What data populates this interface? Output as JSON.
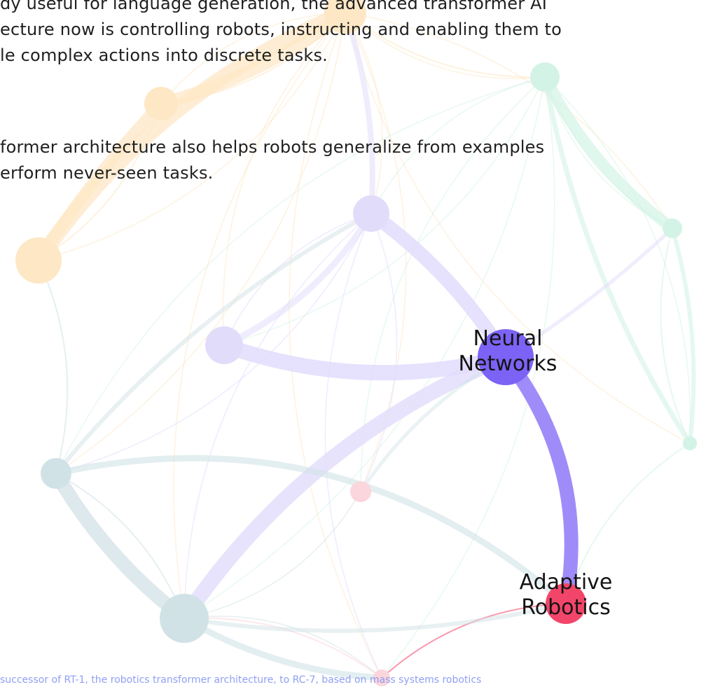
{
  "article": {
    "paragraph1": [
      "dy useful for language generation, the advanced transformer AI",
      "ecture now is controlling robots, instructing and enabling them to",
      "le complex actions into discrete tasks."
    ],
    "paragraph2": [
      "former architecture also helps robots generalize from examples",
      "erform never-seen tasks."
    ],
    "caption": "successor of RT-1, the robotics transformer architecture, to RC-7, based on mass systems robotics"
  },
  "graph": {
    "labels": {
      "neural_networks": [
        "Neural",
        "Networks"
      ],
      "adaptive_robotics": [
        "Adaptive",
        "Robotics"
      ]
    },
    "colors": {
      "orange": "#fde7c5",
      "lavender": "#e2dcfb",
      "mint": "#d3f3e6",
      "teal": "#d1e2e6",
      "pink": "#fbd6dc",
      "highlight_purple": "#7c63f5",
      "highlight_edge": "#a08cf8",
      "highlight_red": "#f2456a"
    }
  }
}
